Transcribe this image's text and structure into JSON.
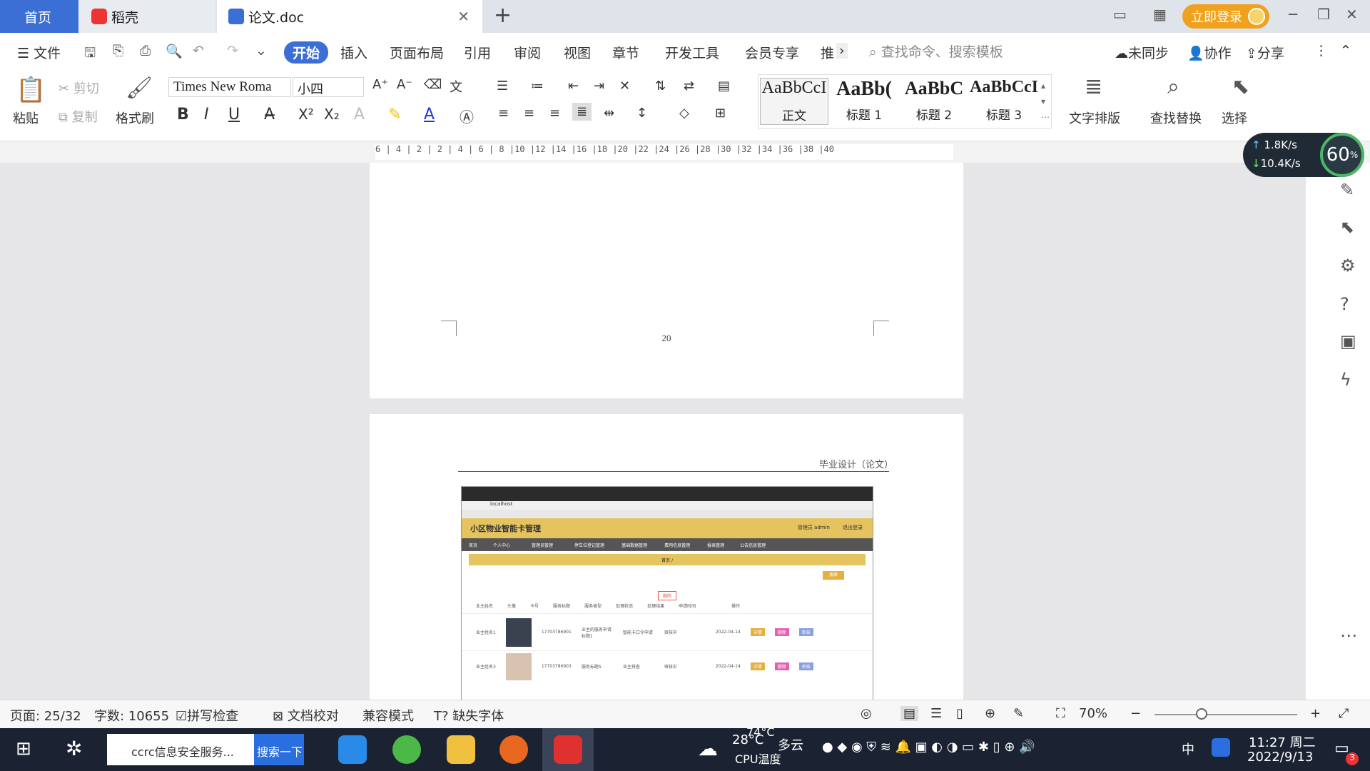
{
  "tabs": {
    "home": "首页",
    "daoke": "稻壳",
    "doc": "论文.doc",
    "login": "立即登录"
  },
  "menu": {
    "file": "文件",
    "items": [
      "开始",
      "插入",
      "页面布局",
      "引用",
      "审阅",
      "视图",
      "章节",
      "开发工具",
      "会员专享",
      "推"
    ],
    "search_placeholder": "查找命令、搜索模板",
    "unsync": "未同步",
    "collab": "协作",
    "share": "分享"
  },
  "ribbon": {
    "paste": "粘贴",
    "cut": "剪切",
    "copy": "复制",
    "format_painter": "格式刷",
    "font": "Times New Roma",
    "size": "小四",
    "styles": [
      {
        "sample": "AaBbCcI",
        "label": "正文"
      },
      {
        "sample": "AaBb(",
        "label": "标题 1"
      },
      {
        "sample": "AaBbC",
        "label": "标题 2"
      },
      {
        "sample": "AaBbCcI",
        "label": "标题 3"
      }
    ],
    "text_layout": "文字排版",
    "find_replace": "查找替换",
    "select": "选择"
  },
  "ruler": {
    "ticks": "6 | 4 | 2 |   2 | 4 | 6 | 8 |10 |12 |14 |16 |18 |20 |22 |24 |26 |28 |30 |32 |34 |36 |38 |40"
  },
  "document": {
    "page_number": "20",
    "header_text": "毕业设计（论文）",
    "screenshot": {
      "title": "小区物业智能卡管理",
      "url": "localhost",
      "admin": "管理员 admin",
      "logout": "退出登录",
      "nav": [
        "首页",
        "个人中心",
        "管理员管理",
        "停车位登记管理",
        "基础数据管理",
        "费用信息管理",
        "报表管理",
        "公告信息管理"
      ],
      "crumb": "首页 / ",
      "search_btn": "搜索",
      "delete_btn": "删除",
      "headers": [
        "业主姓名",
        "头像",
        "卡号",
        "服务标题",
        "服务类型",
        "处理状态",
        "处理结果",
        "申请时间",
        "操作"
      ],
      "rows": [
        {
          "name": "业主姓名1",
          "card": "17703786901",
          "title": "业主的服务申请标题1",
          "type": "智能卡口令申请",
          "status": "审核中",
          "date": "2022-04-14"
        },
        {
          "name": "业主姓名3",
          "card": "17703786903",
          "title": "服务标题5",
          "type": "业主排查",
          "status": "审核中",
          "date": "2022-04-14"
        }
      ],
      "ops": [
        "详情",
        "删除",
        "审核"
      ]
    }
  },
  "net": {
    "up": "1.8K/s",
    "down": "10.4K/s",
    "cpu": "60"
  },
  "status": {
    "page": "页面: 25/32",
    "words": "字数: 10655",
    "spell": "拼写检查",
    "proof": "文档校对",
    "compat": "兼容模式",
    "missing_font": "缺失字体",
    "zoom": "70%"
  },
  "taskbar": {
    "search_text": "ccrc信息安全服务...",
    "search_btn": "搜索一下",
    "weather_temp": "28°C",
    "weather": "多云",
    "cpu_temp": "74°C",
    "cpu_label": "CPU温度",
    "ime": "中",
    "time": "11:27 周二",
    "date": "2022/9/13",
    "notif": "3"
  }
}
